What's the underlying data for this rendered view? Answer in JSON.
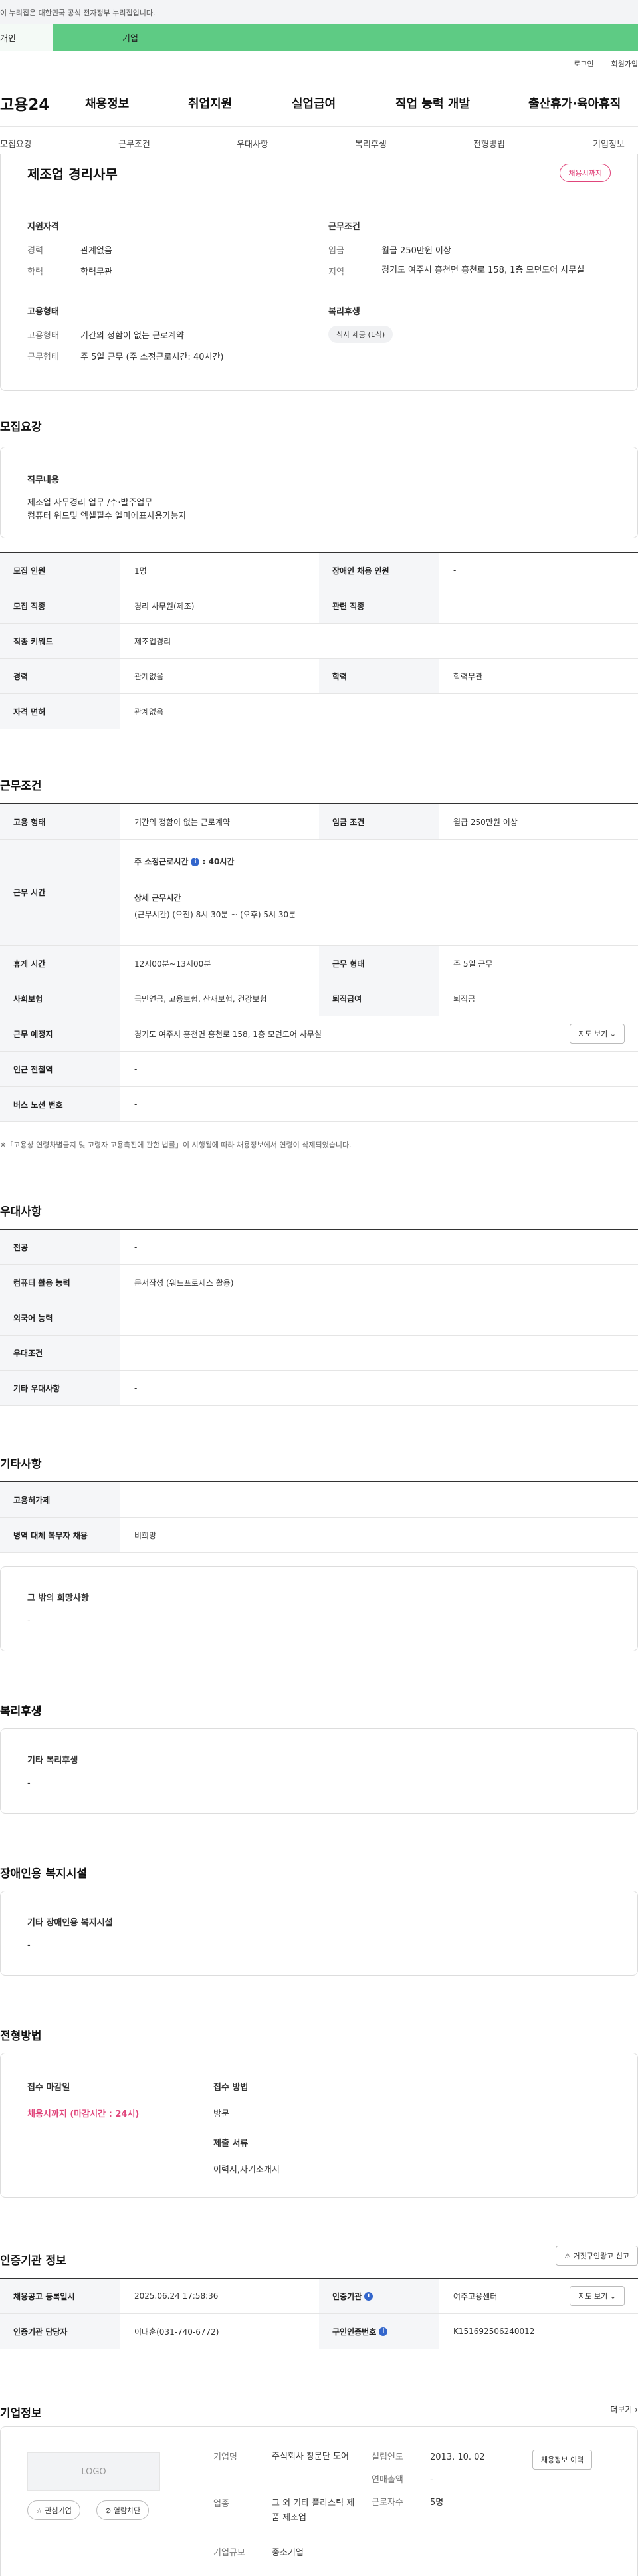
{
  "gov_notice": "이 누리집은 대한민국 공식 전자정부 누리집입니다.",
  "tabs": [
    "개인",
    "기업"
  ],
  "util": [
    "로그인",
    "회원가입"
  ],
  "brand": "고용24",
  "gnb": [
    "채용정보",
    "취업지원",
    "실업급여",
    "직업 능력 개발",
    "출산휴가·육아휴직"
  ],
  "anchors": [
    "모집요강",
    "근무조건",
    "우대사항",
    "복리후생",
    "전형방법",
    "기업정보"
  ],
  "summary": {
    "title": "제조업 경리사무",
    "badge": "채용시까지",
    "qual_heading": "지원자격",
    "qual": [
      {
        "k": "경력",
        "v": "관계없음"
      },
      {
        "k": "학력",
        "v": "학력무관"
      }
    ],
    "cond_heading": "근무조건",
    "cond": [
      {
        "k": "임금",
        "v": "월급 250만원 이상"
      },
      {
        "k": "지역",
        "v": "경기도 여주시 흥천면 흥천로 158, 1층 모던도어 사무실"
      }
    ],
    "emp_heading": "고용형태",
    "emp": [
      {
        "k": "고용형태",
        "v": "기간의 정함이 없는 근로계약"
      },
      {
        "k": "근무형태",
        "v": "주 5일 근무 (주 소정근로시간: 40시간)"
      }
    ],
    "welfare_heading": "복리후생",
    "welfare_pill": "식사 제공 (1식)"
  },
  "recruit": {
    "heading": "모집요강",
    "duty_label": "직무내용",
    "duty_lines": [
      "제조업 사무경리 업무 /수·발주업무",
      "컴퓨터 워드및 엑셀필수 엘마에표사용가능자"
    ],
    "rows": [
      {
        "k1": "모집 인원",
        "v1": "1명",
        "k2": "장애인 채용 인원",
        "v2": "-"
      },
      {
        "k1": "모집 직종",
        "v1": "경리 사무원(제조)",
        "k2": "관련 직종",
        "v2": "-"
      },
      {
        "k1": "직종 키워드",
        "v1": "제조업경리"
      },
      {
        "k1": "경력",
        "v1": "관계없음",
        "k2": "학력",
        "v2": "학력무관"
      },
      {
        "k1": "자격 면허",
        "v1": "관계없음"
      }
    ]
  },
  "work": {
    "heading": "근무조건",
    "emp_type_k": "고용 형태",
    "emp_type_v": "기간의 정함이 없는 근로계약",
    "wage_k": "임금 조건",
    "wage_v": "월급 250만원 이상",
    "hours_k": "근무 시간",
    "hours_week": "주 소정근로시간",
    "hours_week_v": "40시간",
    "hours_detail_label": "상세 근무시간",
    "hours_detail": "(근무시간) (오전) 8시 30분 ~ (오후) 5시 30분",
    "break_k": "휴게 시간",
    "break_v": "12시00분~13시00분",
    "form_k": "근무 형태",
    "form_v": "주 5일 근무",
    "ins_k": "사회보험",
    "ins_v": "국민연금, 고용보험, 산재보험, 건강보험",
    "sev_k": "퇴직급여",
    "sev_v": "퇴직금",
    "place_k": "근무 예정지",
    "place_v": "경기도 여주시 흥천면 흥천로 158, 1층 모던도어 사무실",
    "map_btn": "지도 보기",
    "subway_k": "인근 전철역",
    "subway_v": "-",
    "bus_k": "버스 노선 번호",
    "bus_v": "-",
    "note": "※「고용상 연령차별금지 및 고령자 고용촉진에 관한 법률」이 시행됨에 따라 채용정보에서 연령이 삭제되었습니다."
  },
  "pref": {
    "heading": "우대사항",
    "rows": [
      {
        "k": "전공",
        "v": "-"
      },
      {
        "k": "컴퓨터 활용 능력",
        "v": "문서작성 (워드프로세스 활용)"
      },
      {
        "k": "외국어 능력",
        "v": "-"
      },
      {
        "k": "우대조건",
        "v": "-"
      },
      {
        "k": "기타 우대사항",
        "v": "-"
      }
    ]
  },
  "etc": {
    "heading": "기타사항",
    "rows": [
      {
        "k": "고용허가제",
        "v": "-"
      },
      {
        "k": "병역 대체 복무자 채용",
        "v": "비희망"
      }
    ],
    "box_label": "그 밖의 희망사항",
    "box_value": "-"
  },
  "welfare": {
    "heading": "복리후생",
    "label": "기타 복리후생",
    "value": "-"
  },
  "disabled": {
    "heading": "장애인용 복지시설",
    "label": "기타 장애인용 복지시설",
    "value": "-"
  },
  "selection": {
    "heading": "전형방법",
    "deadline_label": "접수 마감일",
    "deadline_value": "채용시까지 (마감시간 : 24시)",
    "method_label": "접수 방법",
    "method_value": "방문",
    "docs_label": "제출 서류",
    "docs_value": "이력서,자기소개서"
  },
  "cert": {
    "heading": "인증기관 정보",
    "report_btn": "거짓구인광고 신고",
    "rows": [
      {
        "k1": "채용공고 등록일시",
        "v1": "2025.06.24 17:58:36",
        "k2": "인증기관",
        "v2": "여주고용센터",
        "btn": "지도 보기"
      },
      {
        "k1": "인증기관 담당자",
        "v1": "이태훈(031-740-6772)",
        "k2": "구인인증번호",
        "v2": "K151692506240012"
      }
    ]
  },
  "company": {
    "heading": "기업정보",
    "more": "더보기",
    "logo": "LOGO",
    "btn_fav": "관심기업",
    "btn_block": "열람차단",
    "fields": [
      {
        "k": "기업명",
        "v": "주식회사 창문단 도어"
      },
      {
        "k": "업종",
        "v": "그 외 기타 플라스틱 제품 제조업"
      },
      {
        "k": "기업규모",
        "v": "중소기업"
      }
    ],
    "fields2": [
      {
        "k": "설립연도",
        "v": "2013. 10. 02"
      },
      {
        "k": "연매출액",
        "v": "-"
      },
      {
        "k": "근로자수",
        "v": "5명"
      }
    ],
    "hire_btn": "채용정보 이력"
  }
}
